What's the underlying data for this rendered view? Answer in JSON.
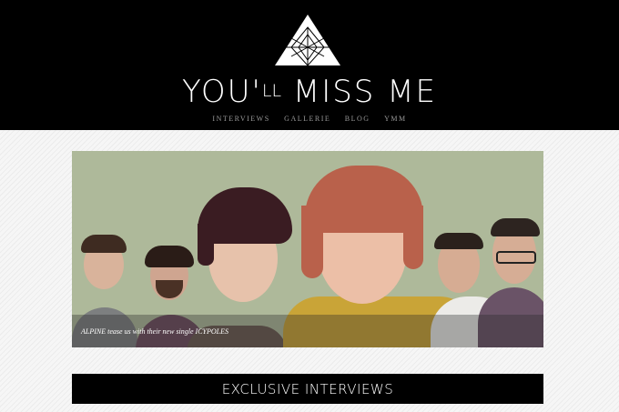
{
  "header": {
    "site_title_main": "YOU'",
    "site_title_sub": "LL",
    "site_title_rest": " MISS ME",
    "nav": [
      "INTERVIEWS",
      "GALLERIE",
      "BLOG",
      "YMM"
    ]
  },
  "hero": {
    "caption": "ALPINE tease us with their new single ICYPOLES",
    "background_color": "#aeb99a"
  },
  "section": {
    "title": "EXCLUSIVE INTERVIEWS"
  },
  "icons": {
    "logo": "geometric-triangle-logo"
  }
}
